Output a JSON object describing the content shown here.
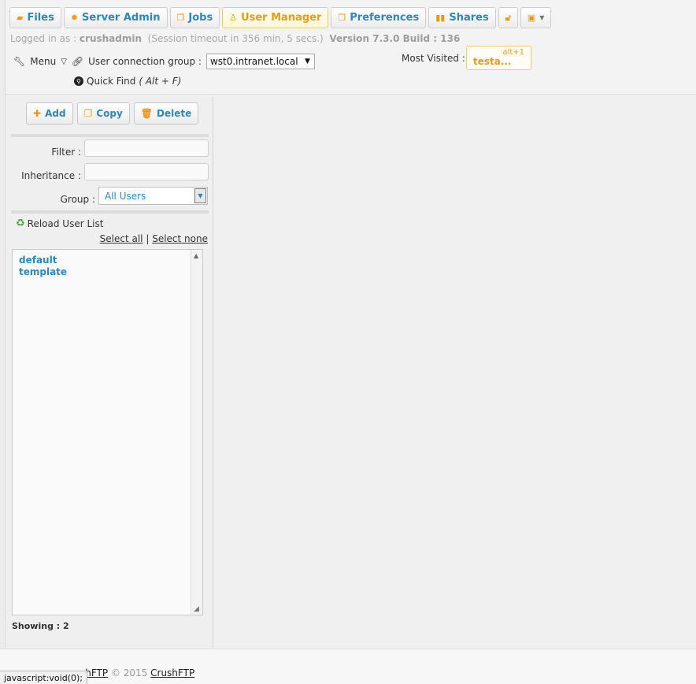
{
  "tabs": [
    {
      "label": "Files",
      "icon": "folder-icon"
    },
    {
      "label": "Server Admin",
      "icon": "gear-icon"
    },
    {
      "label": "Jobs",
      "icon": "copy-icon"
    },
    {
      "label": "User Manager",
      "icon": "user-icon",
      "active": true
    },
    {
      "label": "Preferences",
      "icon": "copy-icon"
    },
    {
      "label": "Shares",
      "icon": "share-icon"
    }
  ],
  "status": {
    "logged_in_prefix": "Logged in as :",
    "username": "crushadmin",
    "session": "(Session timeout in 356 min, 5 secs.)",
    "version": "Version 7.3.0 Build : 136"
  },
  "menu": {
    "label": "Menu",
    "connection_label": "User connection group :",
    "connection_value": "wst0.intranet.local",
    "quickfind_label": "Quick Find",
    "quickfind_shortcut": "( Alt + F)"
  },
  "most_visited": {
    "label": "Most Visited :",
    "shortcut": "alt+1",
    "name": "testa..."
  },
  "toolbar": {
    "add_label": "Add",
    "copy_label": "Copy",
    "delete_label": "Delete"
  },
  "filters": {
    "filter_label": "Filter :",
    "inheritance_label": "Inheritance :",
    "group_label": "Group :",
    "group_value": "All Users"
  },
  "userlist": {
    "reload_label": "Reload User List",
    "select_all": "Select all",
    "separator": "|",
    "select_none": "Select none",
    "items": [
      "default",
      "template"
    ],
    "showing": "Showing : 2"
  },
  "footer": {
    "text_partial": "shFTP",
    "copyright": "© 2015",
    "link": "CrushFTP"
  },
  "statusbar": "javascript:void(0);",
  "colors": {
    "accent": "#2f87b5",
    "active": "#e59c18"
  }
}
